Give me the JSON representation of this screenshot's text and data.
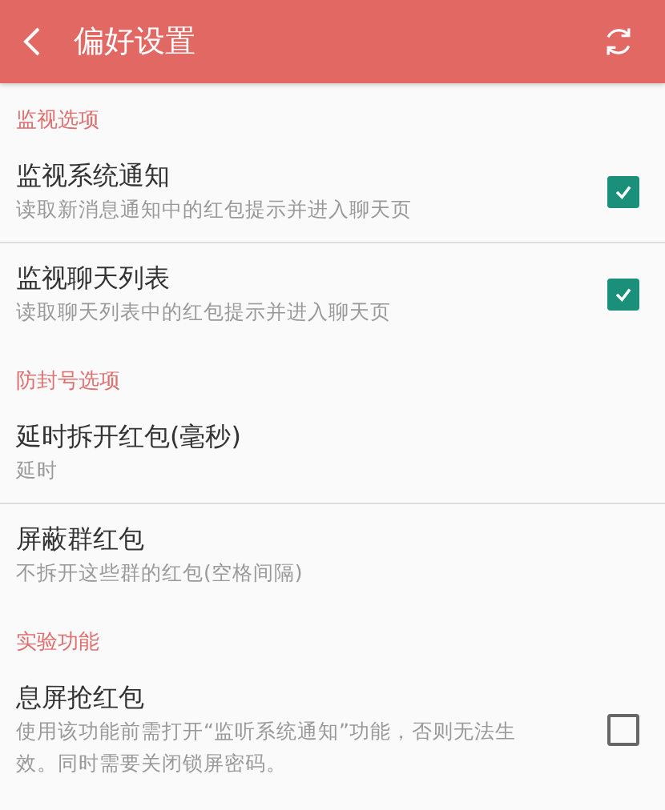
{
  "toolbar": {
    "title": "偏好设置"
  },
  "sections": [
    {
      "title": "监视选项",
      "items": [
        {
          "kind": "checkbox",
          "title": "监视系统通知",
          "summary": "读取新消息通知中的红包提示并进入聊天页",
          "checked": true
        },
        {
          "kind": "checkbox",
          "title": "监视聊天列表",
          "summary": "读取聊天列表中的红包提示并进入聊天页",
          "checked": true
        }
      ]
    },
    {
      "title": "防封号选项",
      "items": [
        {
          "kind": "text",
          "title": "延时拆开红包(毫秒)",
          "summary": "延时"
        },
        {
          "kind": "text",
          "title": "屏蔽群红包",
          "summary": "不拆开这些群的红包(空格间隔)"
        }
      ]
    },
    {
      "title": "实验功能",
      "items": [
        {
          "kind": "checkbox",
          "title": "息屏抢红包",
          "summary": "使用该功能前需打开“监听系统通知”功能，否则无法生效。同时需要关闭锁屏密码。",
          "checked": false
        }
      ]
    }
  ]
}
